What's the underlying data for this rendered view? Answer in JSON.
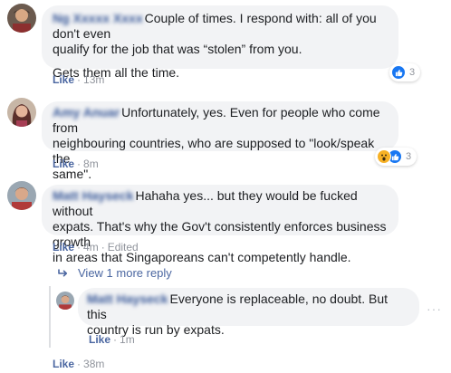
{
  "comments": [
    {
      "author": "Ng Xxxxx Xxxx",
      "text_lines": [
        "Couple of times. I respond with: all of you don't even",
        "qualify for the job that was “stolen” from you."
      ],
      "text_extra": "Gets them all the time.",
      "like_label": "Like",
      "time": "13m",
      "reaction_count": "3",
      "reactions": [
        "like-icon"
      ]
    },
    {
      "author": "Amy Anuar",
      "text_lines": [
        "Unfortunately, yes. Even for people who come from",
        "neighbouring countries, who are supposed to \"look/speak the",
        "same\"."
      ],
      "like_label": "Like",
      "time": "8m",
      "reaction_count": "3",
      "reactions": [
        "wow-icon",
        "like-icon"
      ]
    },
    {
      "author": "Matt Hayseck",
      "text_lines": [
        "Hahaha yes... but they would be fucked without",
        "expats. That's why the Gov't consistently enforces business growth",
        "in areas that Singaporeans can't competently handle."
      ],
      "like_label": "Like",
      "time": "4m",
      "edited": "Edited"
    }
  ],
  "view_more": "View 1 more reply",
  "reply": {
    "author": "Matt Hayseck",
    "text_lines": [
      "Everyone is replaceable, no doubt. But this",
      "country is run by expats."
    ],
    "like_label": "Like",
    "time": "1m",
    "more_dots": "···"
  },
  "bottom": {
    "like_label": "Like",
    "time": "38m"
  },
  "colors": {
    "link": "#4b67a1",
    "bubble": "#f2f3f5",
    "meta": "#90949c",
    "like_reaction": "#1877f2",
    "wow_reaction": "#f7b125"
  }
}
